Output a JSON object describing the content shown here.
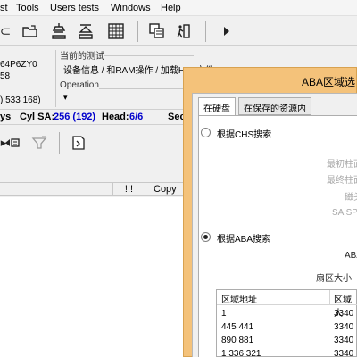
{
  "menubar": {
    "items": [
      "st",
      "Tools",
      "Users tests",
      "Windows",
      "Help"
    ]
  },
  "toolbar": {
    "icons": [
      "disk-icon",
      "open-icon",
      "tower-icon",
      "eject-icon",
      "grid-icon",
      "copy-windows-icon",
      "exit-icon",
      "play-icon"
    ]
  },
  "drive": {
    "serial": "64P6ZY0",
    "line2": "58",
    "size": ") 533 168)"
  },
  "info": {
    "current_test_legend": "当前的测试",
    "current_test_value": "设备信息 / 和RAM操作 / 加载HPA文件",
    "operation_legend": "Operation",
    "operation_value": "▾"
  },
  "status": {
    "ys_label": "ys",
    "cyl_label": "Cyl SA:",
    "cyl_value": "256 (192)",
    "head_label": "Head:",
    "head_value": "6/6",
    "sec_label": "Sec"
  },
  "hex_header": {
    "col1": "!!!",
    "copy_label": "Copy"
  },
  "dialog": {
    "title": "ABA区域选",
    "tabs": [
      "在硬盘",
      "在保存的资源内"
    ],
    "radio_chs": "根据CHS搜索",
    "chs_fields": [
      "最初柱面",
      "最终柱面",
      "磁头",
      "SA SP"
    ],
    "radio_aba": "根据ABA搜索",
    "aba_label": "ABA",
    "sector_size_label": "扇区大小",
    "list": {
      "col1": "区域地址",
      "col2": "区域大",
      "rows": [
        {
          "addr": "1",
          "size": "3340"
        },
        {
          "addr": "445 441",
          "size": "3340"
        },
        {
          "addr": "890 881",
          "size": "3340"
        },
        {
          "addr": "1 336 321",
          "size": "3340"
        }
      ]
    }
  }
}
